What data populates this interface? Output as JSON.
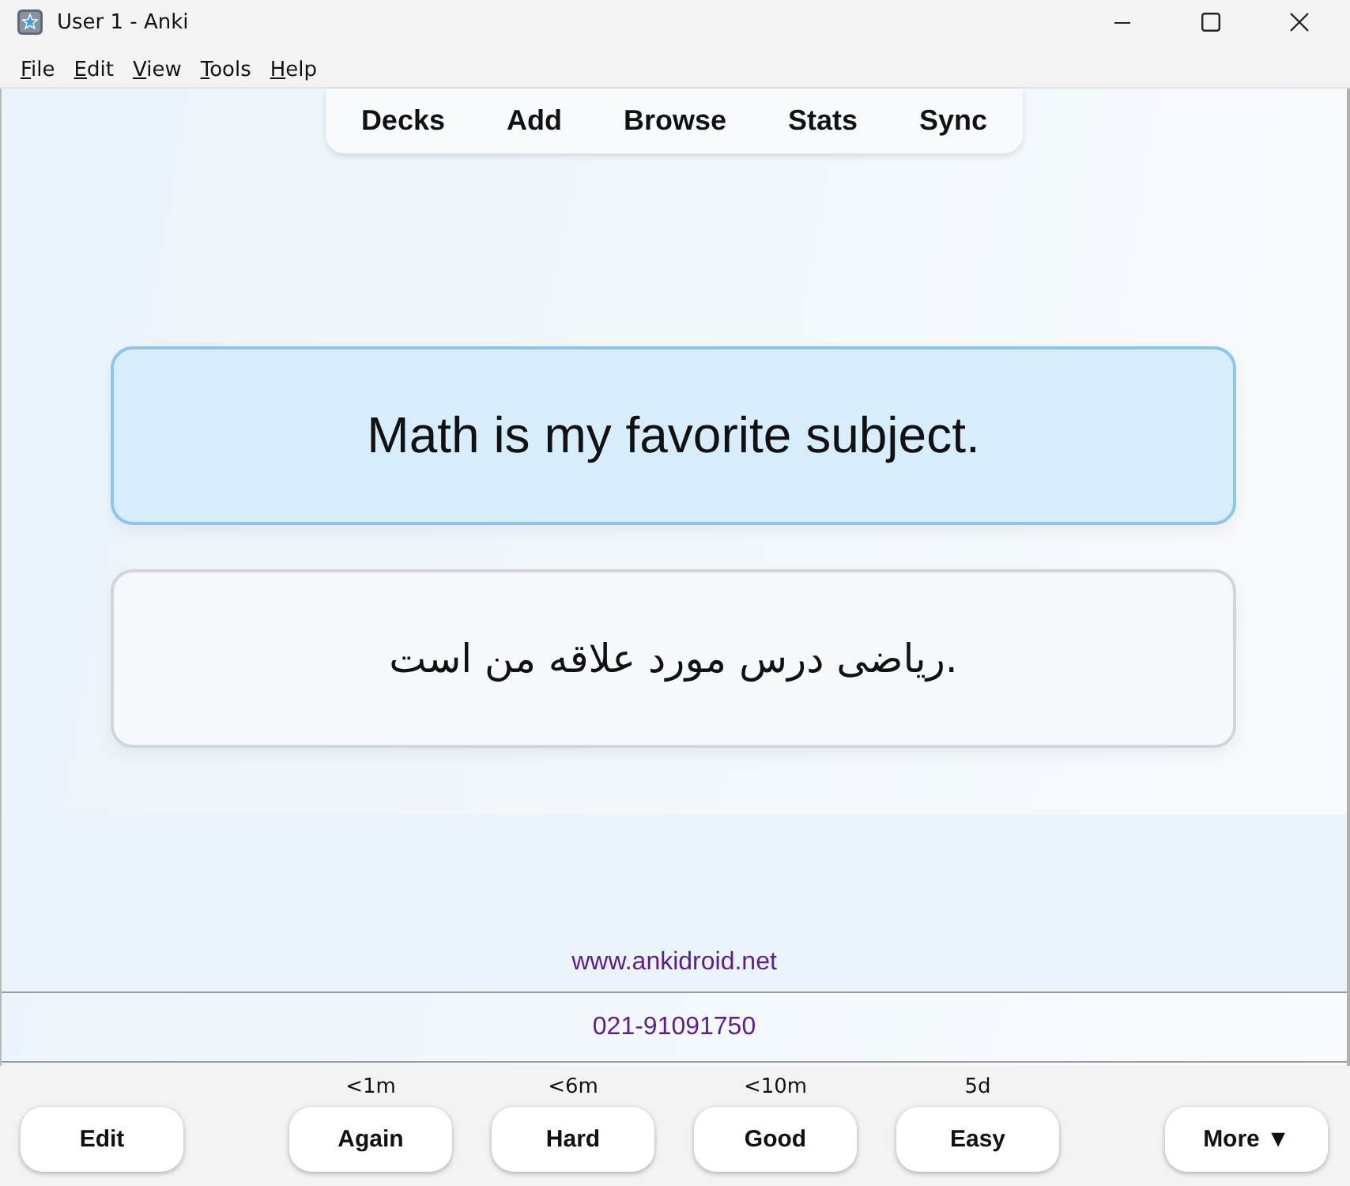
{
  "window": {
    "title": "User 1 - Anki"
  },
  "menu": [
    "File",
    "Edit",
    "View",
    "Tools",
    "Help"
  ],
  "toolbar": [
    "Decks",
    "Add",
    "Browse",
    "Stats",
    "Sync"
  ],
  "card": {
    "question": "Math is my favorite subject.",
    "answer": "ریاضی درس مورد علاقه من است."
  },
  "footer": {
    "link": "www.ankidroid.net",
    "phone": "021-91091750"
  },
  "edit_button": "Edit",
  "ease_buttons": [
    {
      "interval": "<1m",
      "label": "Again"
    },
    {
      "interval": "<6m",
      "label": "Hard"
    },
    {
      "interval": "<10m",
      "label": "Good"
    },
    {
      "interval": "5d",
      "label": "Easy"
    }
  ],
  "more_button": "More ▼"
}
